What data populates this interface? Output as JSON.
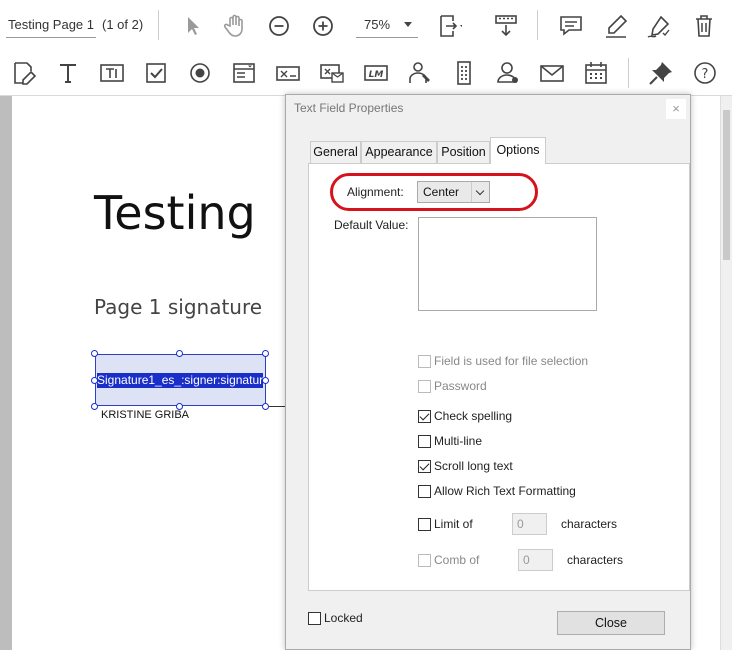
{
  "toolbar": {
    "page_name": "Testing Page 1",
    "page_count": "(1 of 2)",
    "zoom": "75%",
    "icons_row1": [
      "select-arrow-icon",
      "hand-icon",
      "zoom-out-icon",
      "zoom-in-icon",
      "fit-page-icon",
      "scroll-mode-icon",
      "comment-icon",
      "highlight-icon",
      "sign-icon",
      "delete-icon"
    ],
    "icons_row2": [
      "edit-form-icon",
      "text-tool-icon",
      "text-field-icon",
      "checkbox-tool-icon",
      "radio-tool-icon",
      "list-box-icon",
      "dropdown-tool-icon",
      "image-field-icon",
      "logo-field-icon",
      "signer-icon",
      "phone-icon",
      "person-icon",
      "email-icon",
      "calendar-icon",
      "pin-icon",
      "help-icon"
    ]
  },
  "document": {
    "title": "Testing",
    "subtitle": "Page 1 signature",
    "field_text": "Signature1_es_:signer:signature",
    "signer_name": "KRISTINE GRIBA"
  },
  "dialog": {
    "title": "Text Field Properties",
    "close_x": "×",
    "tabs": [
      "General",
      "Appearance",
      "Position",
      "Options"
    ],
    "active_tab": "Options",
    "alignment_label": "Alignment:",
    "alignment_value": "Center",
    "default_value_label": "Default Value:",
    "options": [
      {
        "label": "Field is used for file selection",
        "checked": false,
        "disabled": true
      },
      {
        "label": "Password",
        "checked": false,
        "disabled": true
      },
      {
        "label": "Check spelling",
        "checked": true,
        "disabled": false
      },
      {
        "label": "Multi-line",
        "checked": false,
        "disabled": false
      },
      {
        "label": "Scroll long text",
        "checked": true,
        "disabled": false
      },
      {
        "label": "Allow Rich Text Formatting",
        "checked": false,
        "disabled": false
      }
    ],
    "limit_label": "Limit of",
    "limit_value": "0",
    "limit_unit": "characters",
    "comb_label": "Comb of",
    "comb_value": "0",
    "comb_unit": "characters",
    "locked_label": "Locked",
    "close_button": "Close"
  },
  "colors": {
    "annotation": "#d6121c",
    "field_selection": "#1a2fc9"
  }
}
